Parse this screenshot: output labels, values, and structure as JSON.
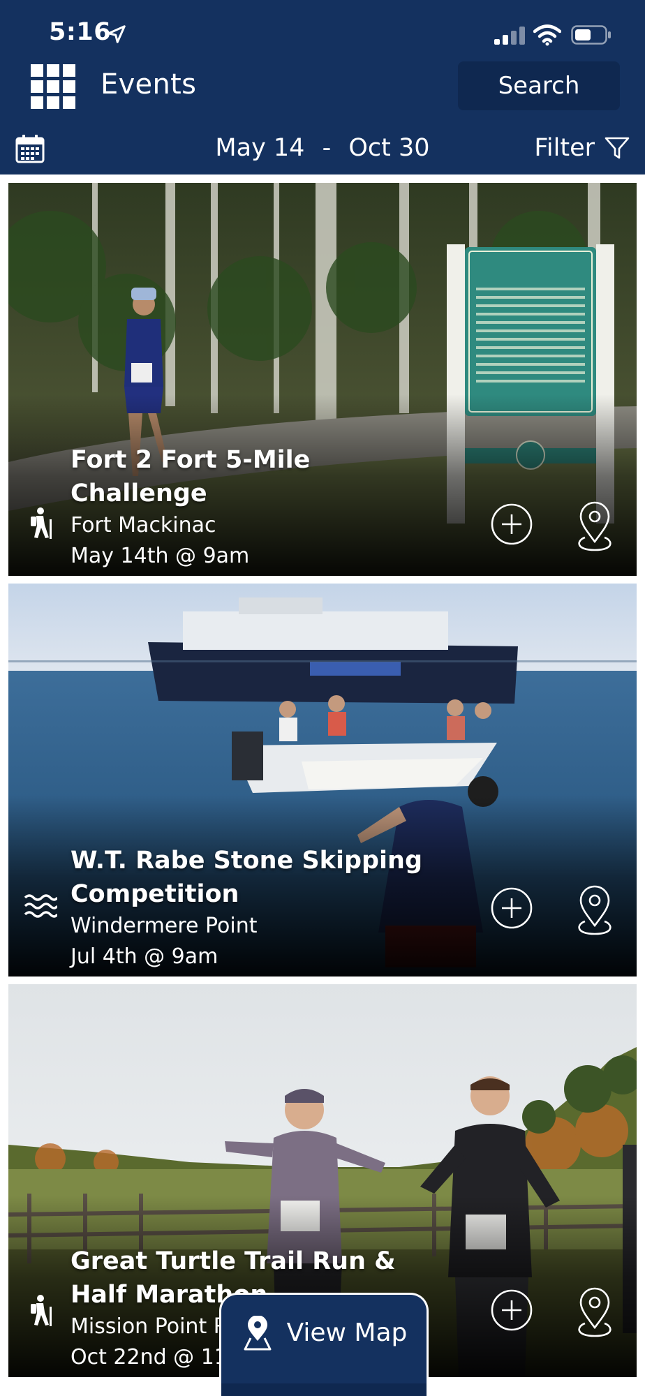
{
  "status_bar": {
    "time": "5:16"
  },
  "header": {
    "title": "Events",
    "search_label": "Search"
  },
  "filter_bar": {
    "date_start": "May 14",
    "date_separator": "-",
    "date_end": "Oct 30",
    "filter_label": "Filter"
  },
  "events": [
    {
      "title": "Fort 2 Fort 5-Mile Challenge",
      "venue": "Fort Mackinac",
      "when": "May 14th @ 9am",
      "category_icon": "hiking-icon"
    },
    {
      "title": "W.T. Rabe Stone Skipping Competition",
      "venue": "Windermere Point",
      "when": "Jul 4th @ 9am",
      "category_icon": "water-waves-icon"
    },
    {
      "title": "Great Turtle Trail Run & Half Marathon",
      "venue": "Mission Point R",
      "when": "Oct 22nd @ 11",
      "category_icon": "hiking-icon"
    }
  ],
  "view_map_label": "View Map",
  "colors": {
    "header": "#14315f",
    "search_bg": "#0f2850",
    "background": "#ffffff"
  }
}
